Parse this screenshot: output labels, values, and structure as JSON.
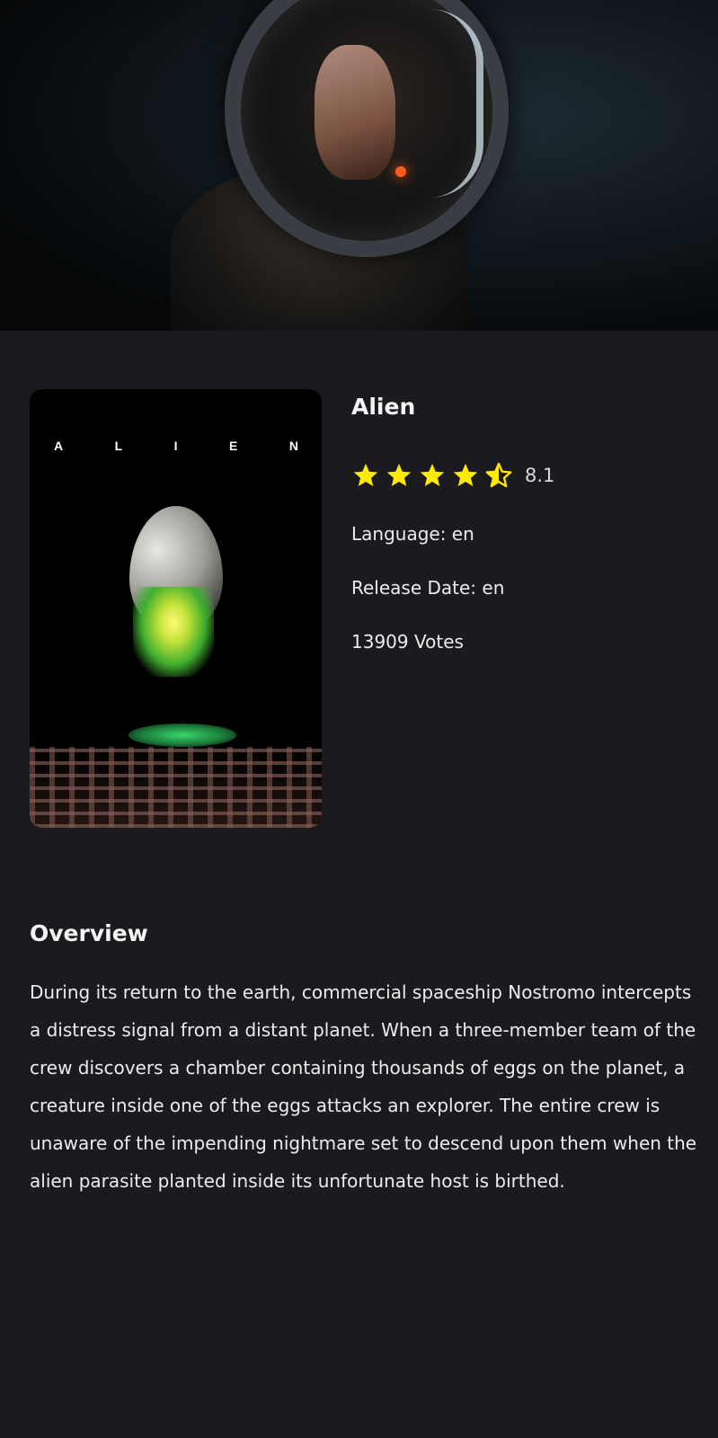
{
  "movie": {
    "title": "Alien",
    "rating_value": "8.1",
    "rating_stars": 4.5,
    "rating_max_stars": 5,
    "language_line": "Language: en",
    "release_line": "Release Date: en",
    "votes_line": "13909 Votes"
  },
  "poster": {
    "letters": [
      "A",
      "L",
      "I",
      "E",
      "N"
    ]
  },
  "overview": {
    "heading": "Overview",
    "text": "During its return to the earth, commercial spaceship Nostromo intercepts a distress signal from a distant planet. When a three-member team of the crew discovers a chamber containing thousands of eggs on the planet, a creature inside one of the eggs attacks an explorer. The entire crew is unaware of the impending nightmare set to descend upon them when the alien parasite planted inside its unfortunate host is birthed."
  },
  "colors": {
    "background": "#1b1b1f",
    "star": "#ffeb00",
    "text": "#ececec"
  },
  "icons": {
    "full_star": "star-icon",
    "half_star": "half-star-icon"
  }
}
